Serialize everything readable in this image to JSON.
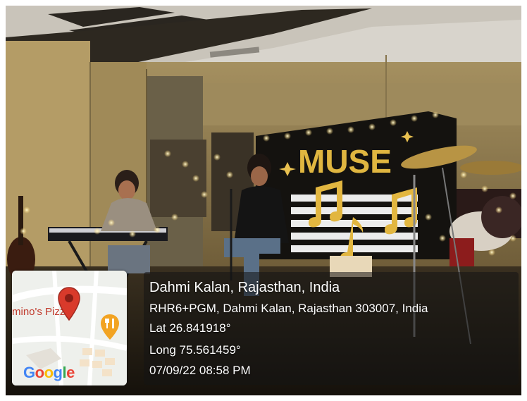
{
  "stamp": {
    "place": "Dahmi Kalan, Rajasthan, India",
    "address": "RHR6+PGM, Dahmi Kalan, Rajasthan 303007, India",
    "lat": "Lat 26.841918°",
    "long": "Long 75.561459°",
    "datetime": "07/09/22 08:58 PM"
  },
  "map": {
    "poi_label": "mino's Pizza",
    "provider_logo": "Google",
    "marker_icon": "map-pin-icon",
    "poi_icon": "restaurant-icon",
    "marker_color": "#d93a2b",
    "poi_color": "#f2a322"
  },
  "scene": {
    "banner_text": "MUSE"
  }
}
